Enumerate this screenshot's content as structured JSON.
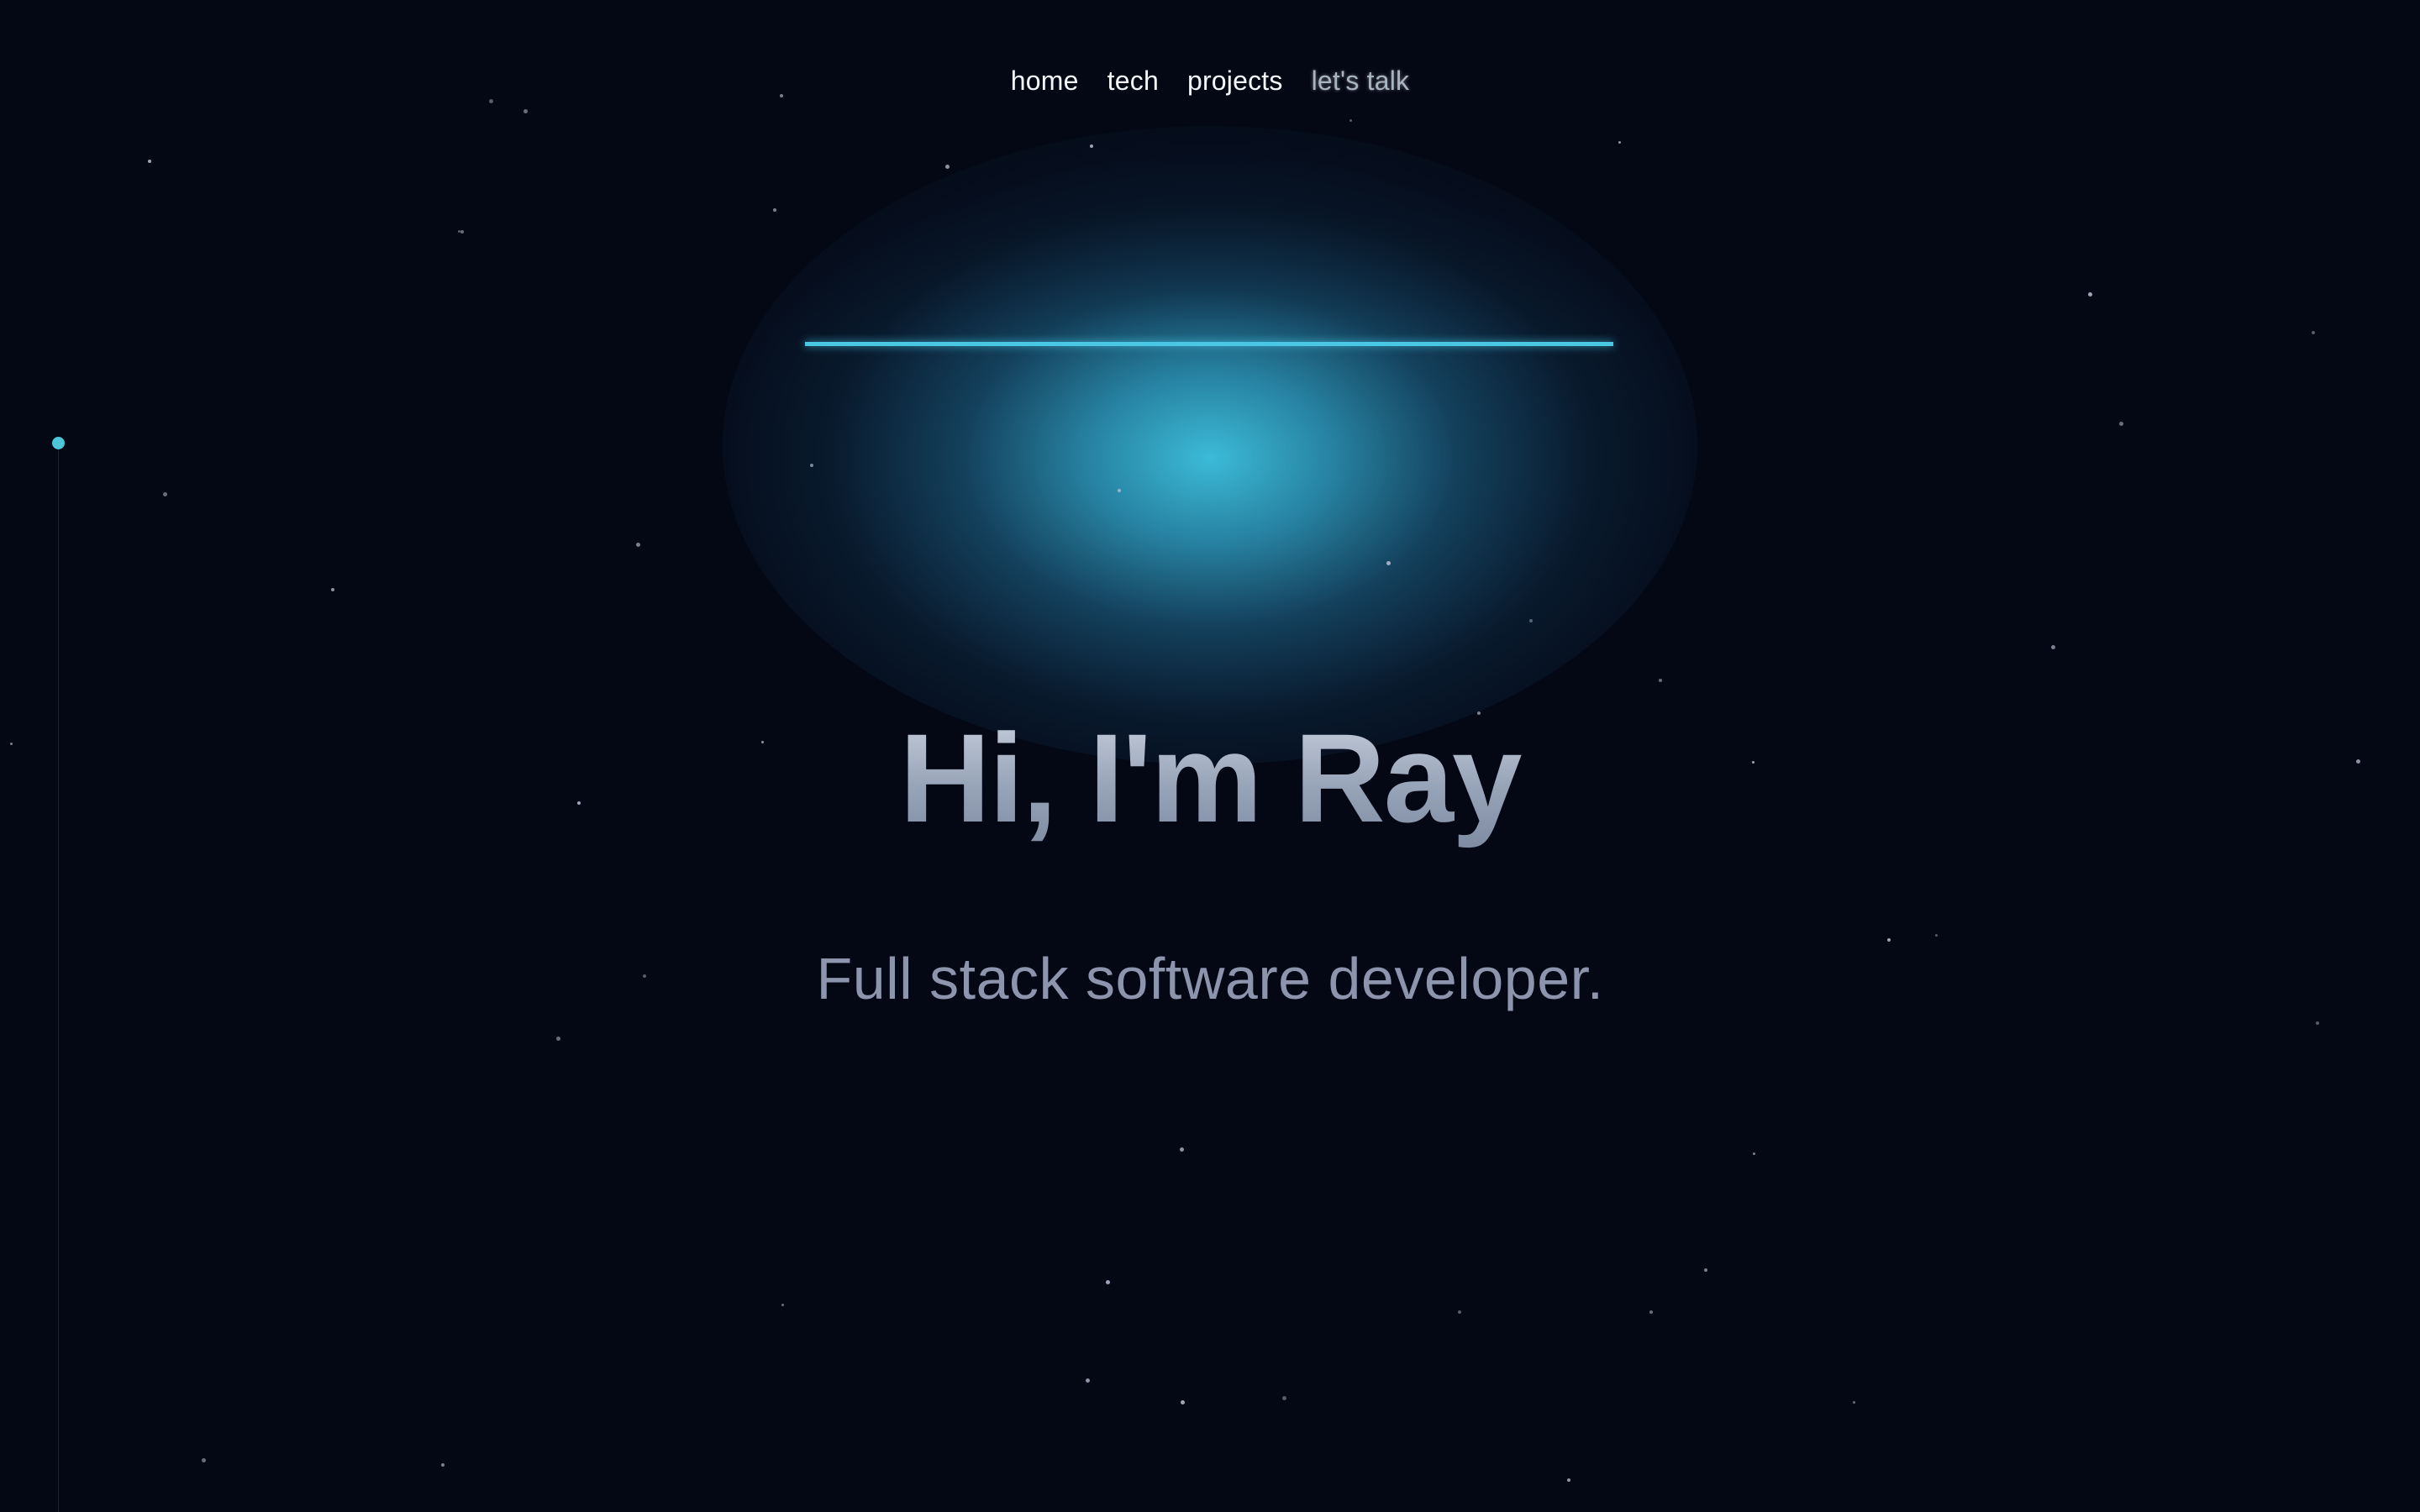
{
  "nav": {
    "items": [
      {
        "label": "home",
        "active": false
      },
      {
        "label": "tech",
        "active": false
      },
      {
        "label": "projects",
        "active": false
      },
      {
        "label": "let's talk",
        "active": true
      }
    ]
  },
  "hero": {
    "title": "Hi, I'm Ray",
    "subtitle": "Full stack software developer."
  },
  "colors": {
    "background": "#040815",
    "accent": "#49c7e3",
    "title": "#9aa6ba",
    "subtitle": "#8d95ad",
    "nav_text": "#f4f6fa"
  },
  "decor": {
    "scroll_indicator_icon": "dot-rail-icon",
    "background_style": "starfield"
  }
}
